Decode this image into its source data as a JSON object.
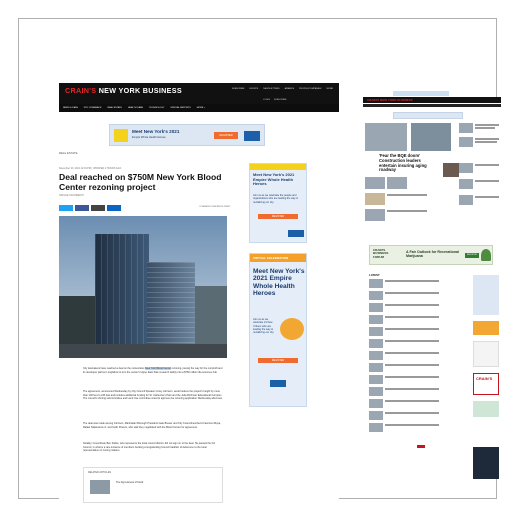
{
  "page1": {
    "logo": {
      "brand": "CRAIN'S",
      "title": "NEW YORK BUSINESS"
    },
    "top_links": [
      "SUBSCRIBE",
      "EVENTS",
      "NEWSLETTERS",
      "AWARDS",
      "PEOPLE/COMPANIES",
      "MORE"
    ],
    "sub_links": [
      "LOGIN",
      "SUBSCRIBE"
    ],
    "nav": [
      "NEWS & DATA",
      "NYC COMEBACK",
      "REAL ESTATE",
      "HEALTH CARE",
      "TECHNOLOGY",
      "SPECIAL REPORTS",
      "MORE +"
    ],
    "banner": {
      "text": "Meet New York's 2021",
      "subtext": "Empire Whole Health Heroes",
      "button": "REGISTER"
    },
    "section": "REAL ESTATE",
    "date": "November 23, 2021 12:04 PM  |  UPDATED 2 HOURS AGO",
    "headline": "Deal reached on $750M New York Blood Center rezoning project",
    "byline": "NATALIE SACHMECHI",
    "share": {
      "right": "COMMENTS   REPRINTS   PRINT"
    },
    "caption": "",
    "paragraphs": [
      "City lawmakers have reached a deal on the contentious New York Blood Center rezoning, paving the way for the nonprofit and its developer partner Longfellow to turn the center's Upper East Side research facility into a $750 million life-sciences hub.",
      "The agreement, announced Wednesday by City Council Speaker Corey Johnson, would reduce the project's height by more than 100 feet to 233 feet and includes additional funding for St. Catherine's Park and the Julia Richman Educational Complex. The council's Zoning subcommittee and Land Use committee voted to approve the rezoning application Wednesday afternoon.",
      "The deal was made among Johnson, Manhattan Borough President Gale Brewer and City Councilmembers Francisco Moya, Rafael Salamanca Jr. and Keith Powers, who said they negotiated with the Blood Center for agreement.",
      "Notably, Councilman Ben Kallos, who represents the local council district, did not sign on to the deal. He passed the full Council, in what is a rare instance of members bucking a longstanding Council tradition of deference to the local representative on zoning matters."
    ],
    "highlight": "New York Blood Center",
    "related": {
      "label": "RELATED ARTICLES",
      "item": "The big business of blood"
    },
    "ad1": {
      "title": "Meet New York's 2021 Empire Whole Health Heroes",
      "body": "Join us as we celebrate the people and organizations who are leading the way in revitalizing our city.",
      "button": "REGISTER"
    },
    "ad2": {
      "top": "VIRTUAL CELEBRATION",
      "title": "Meet New York's 2021 Empire Whole Health Heroes",
      "body": "Join us as we celebrate 21 New Yorkers who are leading the way to revitalizing our city.",
      "button": "REGISTER"
    }
  },
  "page2": {
    "logo": "CRAIN'S NEW YORK BUSINESS",
    "headline1": "'Fear the BQE doom' Construction leaders entertain insuring aging roadway",
    "forum": {
      "brand": "CRAIN'S BUSINESS FORUM",
      "text": "A Fair Outlook for Recreational Marijuana",
      "button": "REGISTER"
    },
    "latest": "LATEST",
    "crains": "CRAIN'S"
  }
}
